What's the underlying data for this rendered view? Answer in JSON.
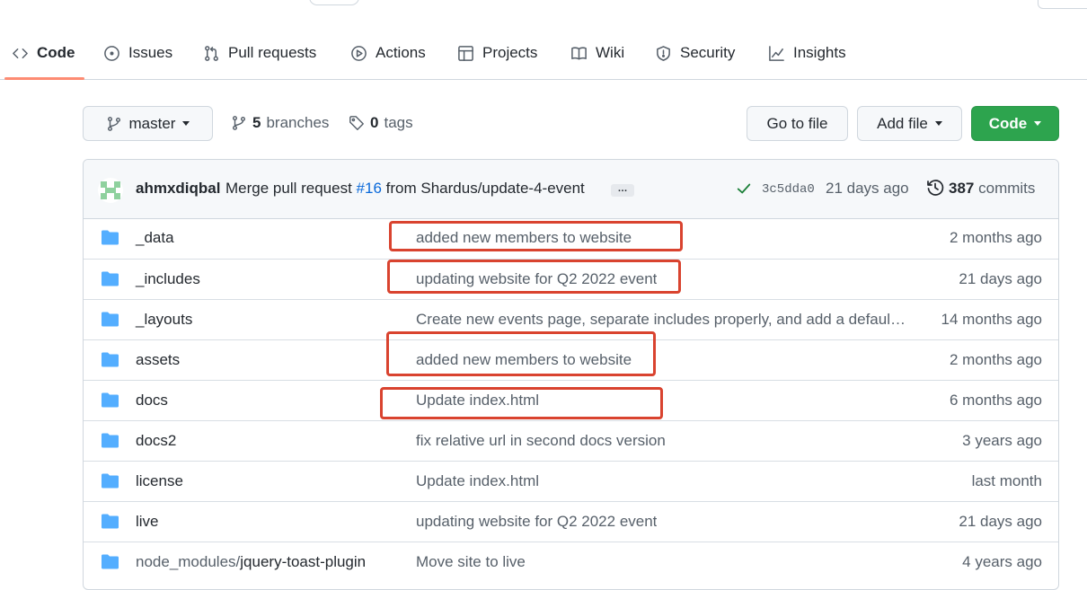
{
  "tabs": [
    {
      "label": "Code",
      "icon": "code-icon",
      "active": true
    },
    {
      "label": "Issues",
      "icon": "issue-icon"
    },
    {
      "label": "Pull requests",
      "icon": "pull-request-icon"
    },
    {
      "label": "Actions",
      "icon": "play-icon"
    },
    {
      "label": "Projects",
      "icon": "table-icon"
    },
    {
      "label": "Wiki",
      "icon": "book-icon"
    },
    {
      "label": "Security",
      "icon": "shield-icon"
    },
    {
      "label": "Insights",
      "icon": "graph-icon"
    }
  ],
  "branch": {
    "name": "master",
    "branches_count": "5",
    "branches_label": "branches",
    "tags_count": "0",
    "tags_label": "tags"
  },
  "actions": {
    "go_to_file": "Go to file",
    "add_file": "Add file",
    "code": "Code"
  },
  "latest_commit": {
    "author": "ahmxdiqbal",
    "message_prefix": "Merge pull request",
    "pr_number": "#16",
    "message_suffix": "from Shardus/update-4-event",
    "ellipsis": "…",
    "sha": "3c5dda0",
    "date": "21 days ago",
    "commits_count": "387",
    "commits_label": "commits"
  },
  "files": [
    {
      "name": "_data",
      "message": "added new members to website",
      "age": "2 months ago"
    },
    {
      "name": "_includes",
      "message": "updating website for Q2 2022 event",
      "age": "21 days ago"
    },
    {
      "name": "_layouts",
      "message": "Create new events page, separate includes properly, and add a default layout",
      "age": "14 months ago"
    },
    {
      "name": "assets",
      "message": "added new members to website",
      "age": "2 months ago"
    },
    {
      "name": "docs",
      "message": "Update index.html",
      "age": "6 months ago"
    },
    {
      "name": "docs2",
      "message": "fix relative url in second docs version",
      "age": "3 years ago"
    },
    {
      "name": "license",
      "message": "Update index.html",
      "age": "last month"
    },
    {
      "name": "live",
      "message": "updating website for Q2 2022 event",
      "age": "21 days ago"
    },
    {
      "name_prefix": "node_modules/",
      "name": "jquery-toast-plugin",
      "message": "Move site to live",
      "age": "4 years ago"
    }
  ],
  "colors": {
    "accent": "#0969da",
    "highlight": "#d9432f",
    "green": "#2da44e",
    "folder": "#54aeff",
    "tab_underline": "#fd8c73"
  }
}
